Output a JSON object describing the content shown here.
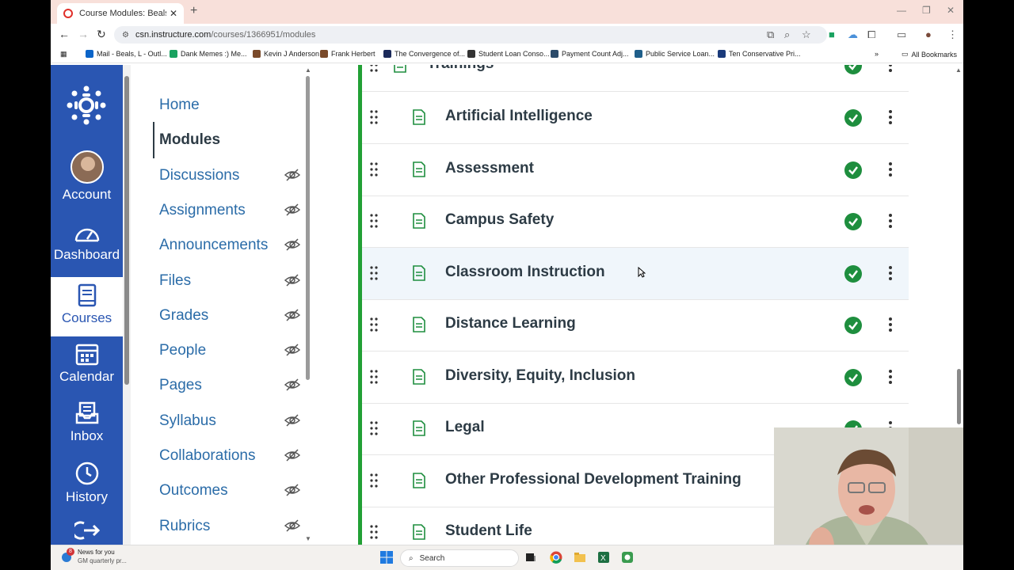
{
  "browser": {
    "tab_title": "Course Modules: Beals Tenure & ...",
    "url_host": "csn.instructure.com",
    "url_path": "/courses/1366951/modules",
    "bookmarks": [
      {
        "label": "Mail - Beals, L - Outl...",
        "color": "#0a64c8"
      },
      {
        "label": "Dank Memes :) Me...",
        "color": "#1aa260"
      },
      {
        "label": "Kevin J Anderson",
        "color": "#7a4a2a"
      },
      {
        "label": "Frank Herbert",
        "color": "#7a4a2a"
      },
      {
        "label": "The Convergence of...",
        "color": "#1b2a5a"
      },
      {
        "label": "Student Loan Conso...",
        "color": "#333333"
      },
      {
        "label": "Payment Count Adj...",
        "color": "#2b4b6a"
      },
      {
        "label": "Public Service Loan...",
        "color": "#1f5f8a"
      },
      {
        "label": "Ten Conservative Pri...",
        "color": "#1a3a7a"
      }
    ],
    "all_bookmarks": "All Bookmarks"
  },
  "global_nav": {
    "items": [
      {
        "label": "Account",
        "icon": "avatar"
      },
      {
        "label": "Dashboard",
        "icon": "dashboard-icon"
      },
      {
        "label": "Courses",
        "icon": "courses-icon"
      },
      {
        "label": "Calendar",
        "icon": "calendar-icon"
      },
      {
        "label": "Inbox",
        "icon": "inbox-icon"
      },
      {
        "label": "History",
        "icon": "history-icon"
      }
    ]
  },
  "course_nav": {
    "items": [
      {
        "label": "Home",
        "hidden": false
      },
      {
        "label": "Modules",
        "hidden": false
      },
      {
        "label": "Discussions",
        "hidden": true
      },
      {
        "label": "Assignments",
        "hidden": true
      },
      {
        "label": "Announcements",
        "hidden": true
      },
      {
        "label": "Files",
        "hidden": true
      },
      {
        "label": "Grades",
        "hidden": true
      },
      {
        "label": "People",
        "hidden": true
      },
      {
        "label": "Pages",
        "hidden": true
      },
      {
        "label": "Syllabus",
        "hidden": true
      },
      {
        "label": "Collaborations",
        "hidden": true
      },
      {
        "label": "Outcomes",
        "hidden": true
      },
      {
        "label": "Rubrics",
        "hidden": true
      }
    ]
  },
  "modules": {
    "header_partial": "Trainings",
    "items": [
      {
        "title": "Artificial Intelligence",
        "published": true
      },
      {
        "title": "Assessment",
        "published": true
      },
      {
        "title": "Campus Safety",
        "published": true
      },
      {
        "title": "Classroom Instruction",
        "published": true
      },
      {
        "title": "Distance Learning",
        "published": true
      },
      {
        "title": "Diversity, Equity, Inclusion",
        "published": true
      },
      {
        "title": "Legal",
        "published": true
      },
      {
        "title": "Other Professional Development Training",
        "published": true
      },
      {
        "title": "Student Life",
        "published": true
      }
    ]
  },
  "taskbar": {
    "news_title": "News for you",
    "news_sub": "GM quarterly pr...",
    "news_badge": "8",
    "search_placeholder": "Search"
  },
  "colors": {
    "canvas_blue": "#2a56b2",
    "published_green": "#1e8e3e",
    "module_bar": "#22a035",
    "link_blue": "#2b6ca8"
  }
}
